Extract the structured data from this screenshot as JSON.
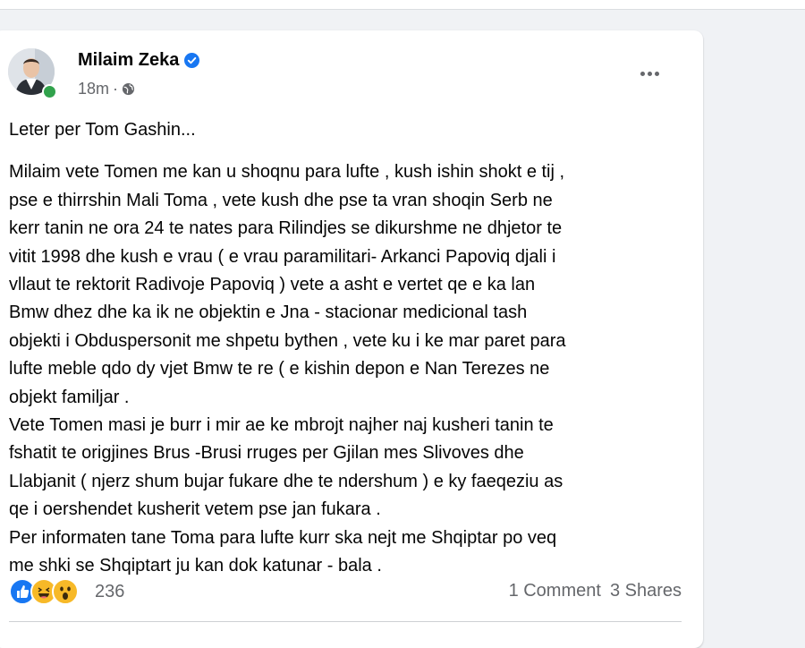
{
  "post": {
    "author": "Milaim Zeka",
    "time": "18m",
    "meta_separator": "·",
    "paragraphs": [
      [
        "Leter per Tom Gashin..."
      ],
      [
        "Milaim vete Tomen me kan u shoqnu para lufte , kush ishin shokt e tij ,",
        "pse e thirrshin Mali Toma , vete kush dhe pse ta vran shoqin Serb ne",
        "kerr tanin ne ora 24 te nates para Rilindjes se dikurshme ne dhjetor te",
        "vitit 1998 dhe kush e vrau ( e vrau paramilitari- Arkanci  Papoviq  djali i",
        "vllaut te rektorit Radivoje Papoviq ) vete a asht e vertet qe e ka lan",
        "Bmw dhez dhe ka ik ne objektin e Jna - stacionar medicional tash",
        "objekti i Obduspersonit me shpetu bythen , vete ku i ke mar paret para",
        "lufte meble qdo dy vjet Bmw te re ( e kishin depon e Nan Terezes ne",
        "objekt familjar .",
        "Vete Tomen masi je burr i mir ae ke mbrojt najher naj kusheri tanin te",
        "fshatit te origjines Brus -Brusi rruges per Gjilan mes Slivoves dhe",
        "Llabjanit ( njerz shum bujar fukare dhe te ndershum ) e ky faeqeziu as",
        "qe i oershendet kusherit  vetem pse jan fukara .",
        "Per informaten tane Toma para lufte kurr ska nejt me Shqiptar po veq",
        "me shki se Shqiptart ju kan dok katunar - bala ."
      ]
    ],
    "reactions": {
      "count": "236",
      "icons": [
        "like-icon",
        "haha-icon",
        "wow-icon"
      ]
    },
    "comments": "1 Comment",
    "shares": "3 Shares"
  },
  "colors": {
    "background": "#f0f2f5",
    "card": "#ffffff",
    "text": "#050505",
    "secondary_text": "#65676b",
    "verified": "#1877f2",
    "online": "#31a24c",
    "like": "#1877f2",
    "haha_wow": "#f7b928"
  }
}
